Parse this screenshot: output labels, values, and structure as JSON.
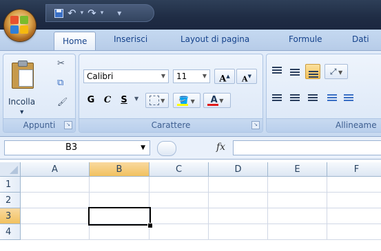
{
  "window": {
    "colors": {
      "titlebar": "#1f2c44",
      "ribbon": "#d5e3f5",
      "accent": "#f1c15f"
    }
  },
  "quick_access": {
    "icons": [
      "save-icon",
      "undo-icon",
      "redo-icon",
      "customize-icon"
    ],
    "undo_glyph": "↶",
    "redo_glyph": "↷",
    "caret": "▾",
    "customize_glyph": "⩧"
  },
  "tabs": [
    {
      "label": "Home",
      "active": true
    },
    {
      "label": "Inserisci"
    },
    {
      "label": "Layout di pagina"
    },
    {
      "label": "Formule"
    },
    {
      "label": "Dati"
    }
  ],
  "ribbon": {
    "clipboard": {
      "paste_label": "Incolla",
      "group_label": "Appunti",
      "cut_glyph": "✂",
      "copy_glyph": "⧉",
      "brush_glyph": "🖌"
    },
    "font": {
      "group_label": "Carattere",
      "font_name": "Calibri",
      "font_size": "11",
      "grow_label": "A",
      "shrink_label": "A",
      "bold_label": "G",
      "italic_label": "C",
      "underline_label": "S",
      "font_color_label": "A"
    },
    "alignment": {
      "group_label": "Allineame"
    }
  },
  "formula_bar": {
    "name_box_value": "B3",
    "fx_label": "fx",
    "formula_value": ""
  },
  "sheet": {
    "columns": [
      "A",
      "B",
      "C",
      "D",
      "E",
      "F"
    ],
    "rows": [
      "1",
      "2",
      "3",
      "4"
    ],
    "selected_column": "B",
    "selected_row": "3",
    "active_cell": "B3"
  }
}
